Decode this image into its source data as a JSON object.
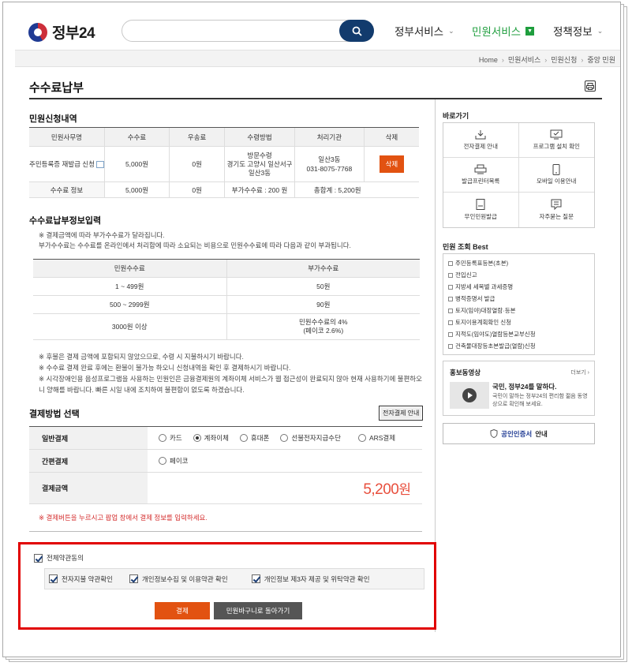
{
  "header": {
    "logo_text": "정부24",
    "search_placeholder": "",
    "nav": [
      {
        "label": "정부서비스"
      },
      {
        "label": "민원서비스"
      },
      {
        "label": "정책정보"
      }
    ]
  },
  "breadcrumb": [
    "Home",
    "민원서비스",
    "민원신청",
    "중앙 민원"
  ],
  "page_title": "수수료납부",
  "application": {
    "title": "민원신청내역",
    "headers": [
      "민원사무명",
      "수수료",
      "우송료",
      "수령방법",
      "처리기관",
      "삭제"
    ],
    "row": {
      "name": "주민등록증 재발급 신청",
      "fee": "5,000원",
      "postage": "0원",
      "method_1": "방문수령",
      "method_2": "경기도 고양시 일산서구",
      "method_3": "일산3동",
      "agency_name": "일산3동",
      "agency_phone": "031-8075-7768",
      "delete_label": "삭제"
    },
    "summary": {
      "label": "수수료 정보",
      "fee": "5,000원",
      "postage": "0원",
      "extra": "부가수수료 : 200 원",
      "total": "총합계 : 5,200원"
    }
  },
  "fee_info": {
    "title": "수수료납부정보입력",
    "note_1": "※ 결제금액에 따라 부가수수료가 달라집니다.",
    "note_2": "부가수수료는 수수료를 온라인에서 처리함에 따라 소요되는 비용으로 민원수수료에 따라 다음과 같이 부과됩니다.",
    "headers": [
      "민원수수료",
      "부가수수료"
    ],
    "rows": [
      {
        "range": "1 ~ 499원",
        "extra": "50원"
      },
      {
        "range": "500 ~ 2999원",
        "extra": "90원"
      },
      {
        "range": "3000원 이상",
        "extra_1": "민원수수료의 4%",
        "extra_2": "(페이코 2.6%)"
      }
    ],
    "notes": [
      "※ 후불은 결제 금액에 포함되지 않았으므로, 수령 시 지불하시기 바랍니다.",
      "※ 수수료 결제 완료 후에는 환불이 불가능 하오니 신청내역을 확인 후 결제하시기 바랍니다.",
      "※ 시각장애인용 음성프로그램을 사용하는 민원인은 금융결제원의 계좌이체 서비스가 웹 접근성이 완료되지 않아 현재 사용하기에 불편하오",
      "니 양해를 바랍니다. 빠른 시일 내에 조치하여 불편함이 없도록 하겠습니다."
    ]
  },
  "payment": {
    "title": "결제방법 선택",
    "epay_guide": "전자결제 안내",
    "general_label": "일반결제",
    "general_options": [
      {
        "label": "카드",
        "selected": false
      },
      {
        "label": "계좌이체",
        "selected": true
      },
      {
        "label": "휴대폰",
        "selected": false
      },
      {
        "label": "선불전자지급수단",
        "selected": false
      },
      {
        "label": "ARS결제",
        "selected": false
      }
    ],
    "simple_label": "간편결제",
    "simple_options": [
      {
        "label": "페이코",
        "selected": false
      }
    ],
    "amount_label": "결제금액",
    "amount_value": "5,200",
    "amount_unit": "원",
    "warning": "※ 결제버튼을 누르시고 팝업 창에서 결제 정보를 입력하세요."
  },
  "agreement": {
    "all_label": "전체약관동의",
    "items": [
      {
        "label": "전자지불 약관확인",
        "checked": true
      },
      {
        "label": "개인정보수집 및 이용약관 확인",
        "checked": true
      },
      {
        "label": "개인정보 제3자 제공 및 위탁약관 확인",
        "checked": true
      }
    ],
    "all_checked": true,
    "pay_label": "결제",
    "back_label": "민원바구니로 돌아가기"
  },
  "side": {
    "quick_title": "바로가기",
    "quick_items": [
      {
        "label": "전자결제 안내",
        "icon": "download-icon"
      },
      {
        "label": "프로그램 설치 확인",
        "icon": "monitor-check-icon"
      },
      {
        "label": "발급프린터목록",
        "icon": "printer-icon"
      },
      {
        "label": "모바일 이용안내",
        "icon": "mobile-icon"
      },
      {
        "label": "무인민원발급",
        "icon": "kiosk-icon"
      },
      {
        "label": "자주묻는 질문",
        "icon": "faq-icon"
      }
    ],
    "best_title": "민원 조회 Best",
    "best_items": [
      "주민등록표등본(초본)",
      "전입신고",
      "지방세 세목별 과세증명",
      "병적증명서 발급",
      "토지(임야)대장열람·등본",
      "토지이용계획확인 신청",
      "지적도(임야도)열람등본교부신청",
      "건축물대장등초본발급(열람)신청"
    ],
    "promo_title": "홍보동영상",
    "promo_more": "더보기",
    "promo_headline": "국민, 정부24를 말하다.",
    "promo_desc": "국민이 말하는 정부24의 편리함 젊음 동영상으로 확인해 보세요.",
    "cert_label": "공인인증서",
    "cert_suffix": "안내"
  },
  "colors": {
    "accent_orange": "#e25211",
    "nav_active_green": "#1f9e3e",
    "search_button": "#123b6d",
    "highlight_red": "#e10000",
    "amount_red": "#e84f3d"
  }
}
